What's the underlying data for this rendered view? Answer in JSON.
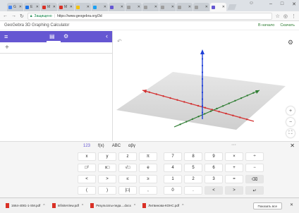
{
  "browser": {
    "tabs": [
      {
        "label": "G",
        "favicon_color": "#4285f4",
        "active": false
      },
      {
        "label": "E",
        "favicon_color": "#1a73e8",
        "active": false
      },
      {
        "label": "M",
        "favicon_color": "#d93025",
        "active": false
      },
      {
        "label": "M",
        "favicon_color": "#d93025",
        "active": false
      },
      {
        "label": "",
        "favicon_color": "#f4c20d",
        "active": false
      },
      {
        "label": "",
        "favicon_color": "#1da1f2",
        "active": false
      },
      {
        "label": "",
        "favicon_color": "#6557d2",
        "active": false
      },
      {
        "label": "",
        "favicon_color": "#9e9e9e",
        "active": false
      },
      {
        "label": "",
        "favicon_color": "#9e9e9e",
        "active": false
      },
      {
        "label": "",
        "favicon_color": "#9e9e9e",
        "active": false
      },
      {
        "label": "",
        "favicon_color": "#9e9e9e",
        "active": false
      },
      {
        "label": "",
        "favicon_color": "#9e9e9e",
        "active": false
      },
      {
        "label": "",
        "favicon_color": "#6557d2",
        "active": true
      }
    ],
    "window_controls": {
      "minimize": "–",
      "maximize": "□",
      "close": "✕"
    },
    "address": {
      "secure_label": "Защищено",
      "url": "https://www.geogebra.org/3d"
    }
  },
  "geogebra": {
    "title": "GeoGebra 3D Graphing Calculator",
    "links": [
      "В начало",
      "Скачать"
    ],
    "algebra_add": "+"
  },
  "keyboard": {
    "tabs": [
      "123",
      "f(x)",
      "ABC",
      "αβγ"
    ],
    "more": "···",
    "close": "✕",
    "rows": [
      [
        "x",
        "y",
        "z",
        "π",
        "7",
        "8",
        "9",
        "×",
        "÷"
      ],
      [
        "□²",
        "x□",
        "√□",
        "e",
        "4",
        "5",
        "6",
        "+",
        "−"
      ],
      [
        "<",
        ">",
        "≤",
        "≥",
        "1",
        "2",
        "3",
        "=",
        "⌫"
      ],
      [
        "(",
        ")",
        "|□|",
        ",",
        "0",
        ".",
        "<",
        ">",
        "↵"
      ]
    ]
  },
  "downloads": {
    "items": [
      {
        "name": "1664-4081-1-SM.pdf"
      },
      {
        "name": "InfiniteView.pdf"
      },
      {
        "name": "Результаты-педа....docx"
      },
      {
        "name": "Литвинова-КОНС.pdf"
      }
    ],
    "show_all": "Показать все",
    "close": "✕"
  },
  "colors": {
    "accent": "#6557d2",
    "axis_x": "#d32f2f",
    "axis_y": "#2e7d32",
    "axis_z": "#1e3fd8",
    "plane": "#d8d8d8"
  }
}
